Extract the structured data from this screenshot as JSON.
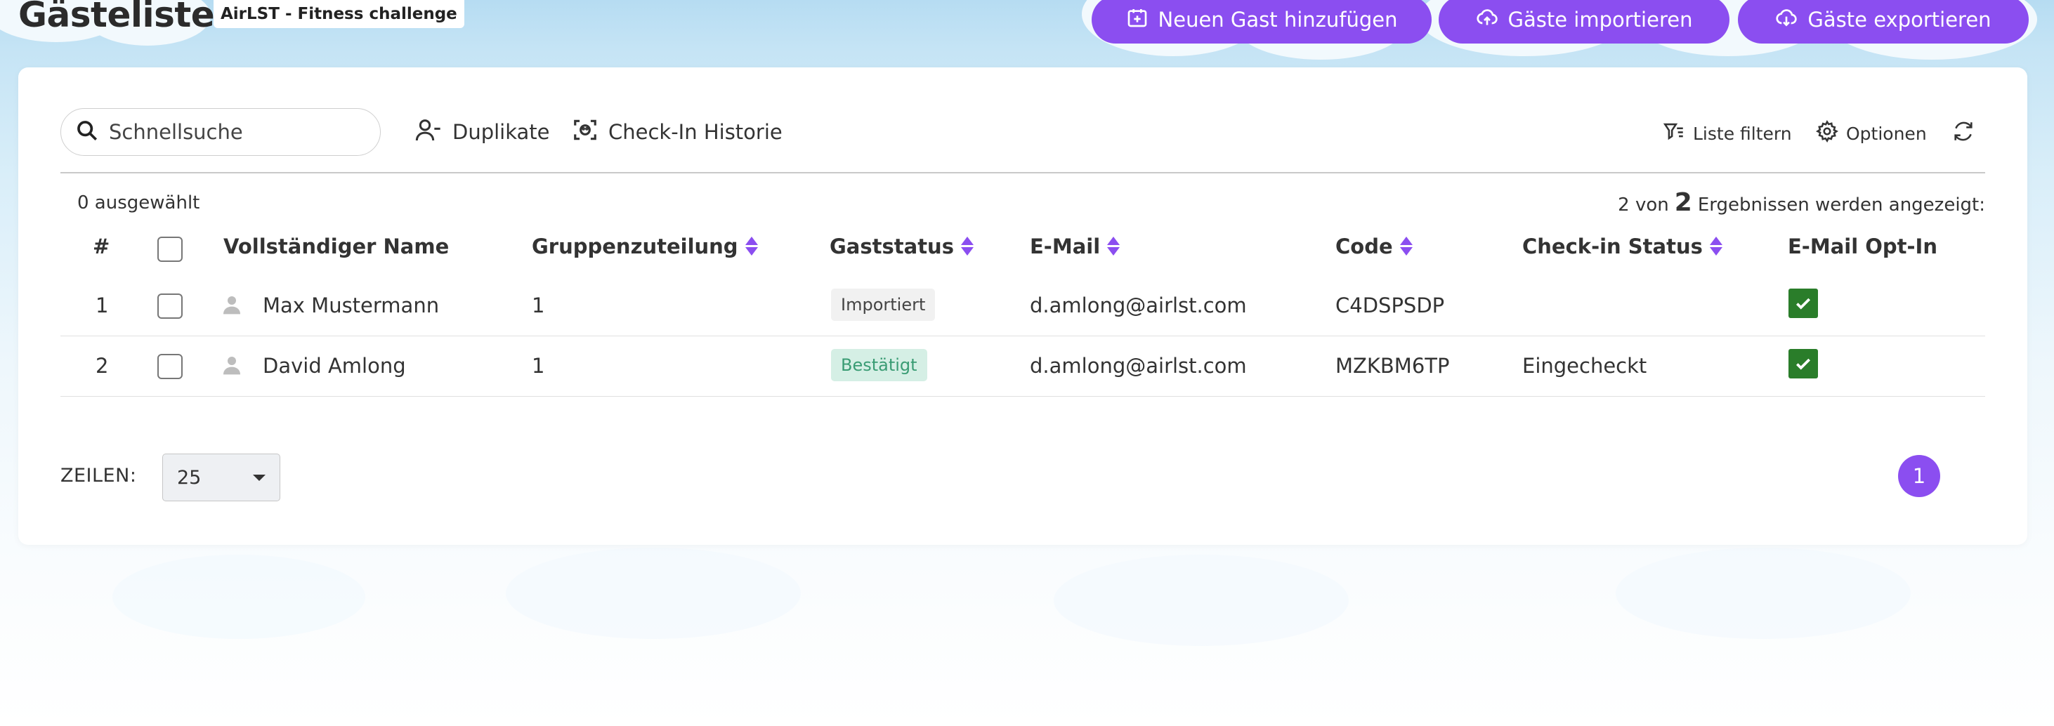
{
  "header": {
    "title": "Gästeliste",
    "event": "AirLST - Fitness challenge",
    "buttons": {
      "add_guest": "Neuen Gast hinzufügen",
      "import": "Gäste importieren",
      "export": "Gäste exportieren"
    }
  },
  "toolbar": {
    "search_placeholder": "Schnellsuche",
    "duplicates": "Duplikate",
    "checkin_history": "Check-In Historie",
    "filter": "Liste filtern",
    "options": "Optionen"
  },
  "summary": {
    "selected": "0 ausgewählt",
    "results_prefix": "2 von",
    "results_count": "2",
    "results_suffix": "Ergebnissen werden angezeigt:"
  },
  "table": {
    "columns": {
      "index": "#",
      "name": "Vollständiger Name",
      "group": "Gruppenzuteilung",
      "status": "Gaststatus",
      "email": "E-Mail",
      "code": "Code",
      "checkin": "Check-in Status",
      "optin": "E-Mail Opt-In"
    },
    "rows": [
      {
        "index": "1",
        "name": "Max Mustermann",
        "group": "1",
        "status": "Importiert",
        "email": "d.amlong@airlst.com",
        "code": "C4DSPSDP",
        "checkin": "",
        "optin": true
      },
      {
        "index": "2",
        "name": "David Amlong",
        "group": "1",
        "status": "Bestätigt",
        "email": "d.amlong@airlst.com",
        "code": "MZKBM6TP",
        "checkin": "Eingecheckt",
        "optin": true
      }
    ]
  },
  "footer": {
    "rows_label": "ZEILEN:",
    "rows_value": "25",
    "page": "1"
  },
  "colors": {
    "accent": "#8b4ef0",
    "optin_green": "#2a7d2a",
    "confirmed_bg": "#d5efe5",
    "confirmed_text": "#3a9c74"
  }
}
